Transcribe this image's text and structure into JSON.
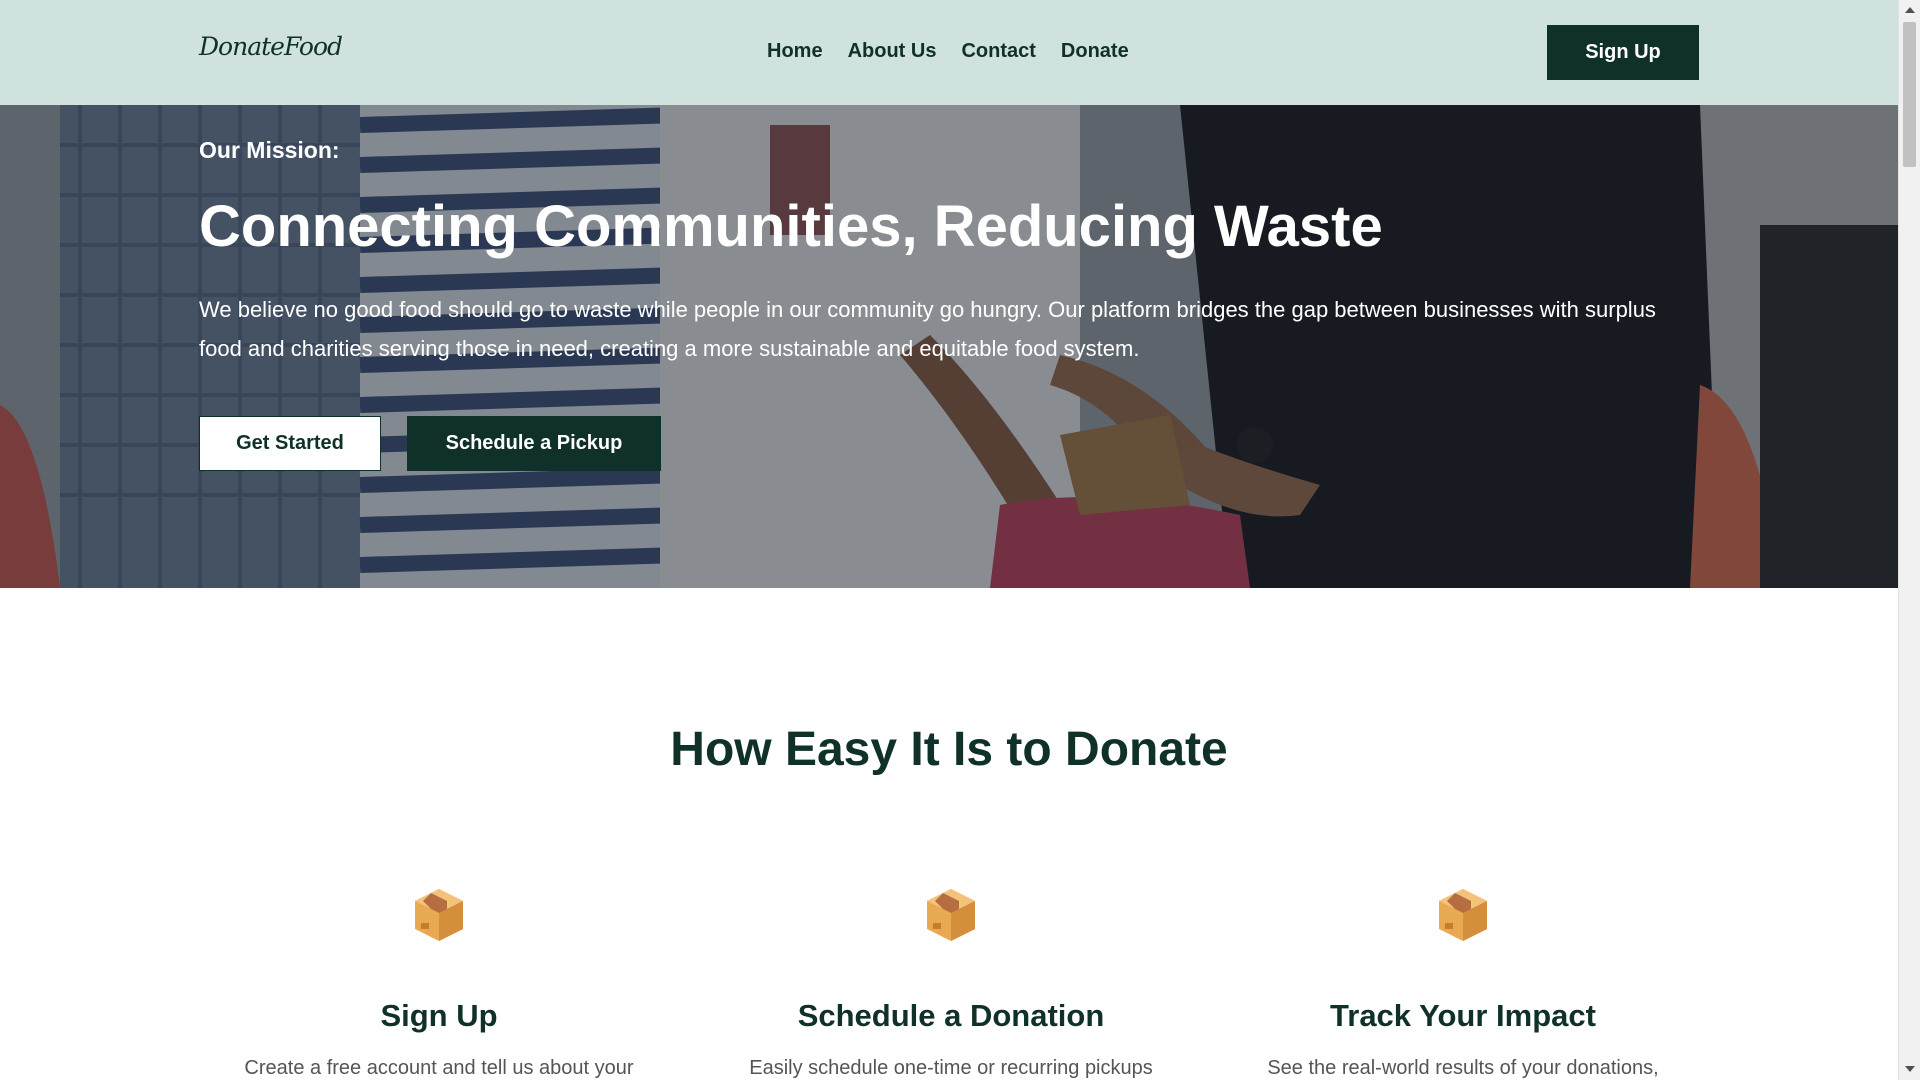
{
  "nav": {
    "logo_text": "DonateFood",
    "links": [
      "Home",
      "About Us",
      "Contact",
      "Donate"
    ],
    "signup_label": "Sign Up"
  },
  "hero": {
    "mission_label": "Our Mission:",
    "title": "Connecting Communities, Reducing Waste",
    "description": "We believe no good food should go to waste while people in our community go hungry. Our platform bridges the gap between businesses with surplus food and charities serving those in need, creating a more sustainable and equitable food system.",
    "primary_button": "Get Started",
    "secondary_button": "Schedule a Pickup"
  },
  "how": {
    "title": "How Easy It Is to Donate",
    "steps": [
      {
        "icon": "package-icon",
        "title": "Sign Up",
        "description": "Create a free account and tell us about your"
      },
      {
        "icon": "package-icon",
        "title": "Schedule a Donation",
        "description": "Easily schedule one-time or recurring pickups"
      },
      {
        "icon": "package-icon",
        "title": "Track Your Impact",
        "description": "See the real-world results of your donations,"
      }
    ]
  },
  "colors": {
    "nav_bg": "#cfe2de",
    "brand_dark": "#10302a",
    "white": "#ffffff"
  }
}
